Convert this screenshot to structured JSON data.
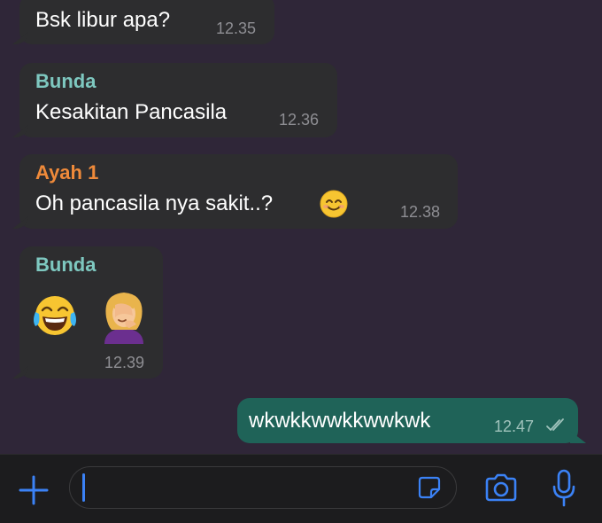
{
  "messages": [
    {
      "sender": "",
      "text": "Bsk libur apa?",
      "time": "12.35"
    },
    {
      "sender": "Bunda",
      "text": "Kesakitan Pancasila",
      "time": "12.36"
    },
    {
      "sender": "Ayah 1",
      "text": "Oh pancasila nya sakit..?",
      "time": "12.38",
      "emoji": "smiling-face-icon"
    },
    {
      "sender": "Bunda",
      "text": "",
      "time": "12.39",
      "emoji": [
        "tears-of-joy-icon",
        "facepalm-woman-icon"
      ]
    },
    {
      "sender": "",
      "text": "wkwkkwwkkwwkwk",
      "time": "12.47",
      "status": "read-double-check-icon"
    }
  ],
  "colors": {
    "background": "#2f2638",
    "incoming_bubble": "#2d2d2f",
    "outgoing_bubble": "#1f6358",
    "sender_bunda": "#7ec8c0",
    "sender_ayah": "#ef8a3a",
    "accent": "#3b82f6"
  },
  "input": {
    "value": "",
    "placeholder": ""
  }
}
